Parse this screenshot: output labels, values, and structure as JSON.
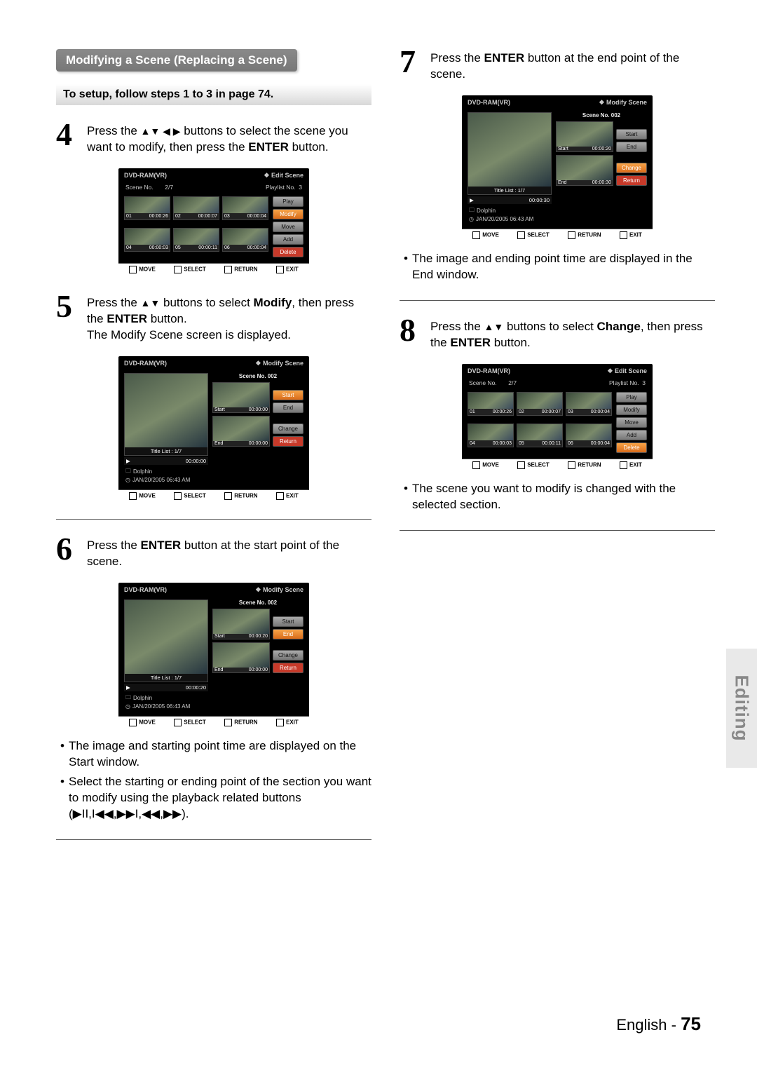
{
  "sidetab": "Editing",
  "footer": {
    "lang": "English -",
    "page": "75"
  },
  "left": {
    "banner": "Modifying a Scene (Replacing a Scene)",
    "subnote": "To setup, follow steps 1 to 3 in page 74.",
    "step4": {
      "num": "4",
      "t1": "Press the ",
      "arrows": "▲▼ ◀ ▶",
      "t2": " buttons to select the scene you want to modify, then press the ",
      "b1": "ENTER",
      "t3": " button."
    },
    "step5": {
      "num": "5",
      "t1": "Press the ",
      "arrows": "▲▼",
      "t2": " buttons to select ",
      "b1": "Modify",
      "t3": ", then press the ",
      "b2": "ENTER",
      "t4": " button.",
      "extra": "The Modify Scene screen is displayed."
    },
    "step6": {
      "num": "6",
      "t1": "Press the ",
      "b1": "ENTER",
      "t2": " button at the start point of the scene."
    },
    "bullets6": [
      "The image and starting point time are displayed on the Start window.",
      "Select the starting or ending point of the section you want to modify using the playback related buttons (▶II,I◀◀,▶▶I,◀◀,▶▶)."
    ]
  },
  "right": {
    "step7": {
      "num": "7",
      "t1": "Press the ",
      "b1": "ENTER",
      "t2": " button at the end point of the scene."
    },
    "bullets7": [
      "The image and ending point time are displayed in the End window."
    ],
    "step8": {
      "num": "8",
      "t1": "Press the ",
      "arrows": "▲▼",
      "t2": " buttons to select ",
      "b1": "Change",
      "t3": ", then press the ",
      "b2": "ENTER",
      "t4": " button."
    },
    "bullets8": [
      "The scene you want to modify is changed with the selected section."
    ]
  },
  "mock_common": {
    "disc": "DVD-RAM(VR)",
    "bottombar": {
      "move": "MOVE",
      "select": "SELECT",
      "return": "RETURN",
      "exit": "EXIT"
    },
    "editscene": "Edit Scene",
    "modifyscene": "Modify Scene",
    "sceneno_row_label": "Scene No.",
    "scenecount": "2/7",
    "playlist_label": "Playlist No.",
    "playlist_num": "3",
    "title_list": "Title List : 1/7",
    "dolphin": "Dolphin",
    "date": "JAN/20/2005 06:43 AM",
    "scene_no_hdr": "Scene No. 002",
    "labels": {
      "start": "Start",
      "end": "End",
      "change": "Change",
      "return": "Return"
    },
    "side": {
      "play": "Play",
      "modify": "Modify",
      "move": "Move",
      "add": "Add",
      "delete": "Delete"
    }
  },
  "mockA": {
    "thumbs": [
      {
        "idx": "01",
        "t": "00:00:26"
      },
      {
        "idx": "02",
        "t": "00:00:07"
      },
      {
        "idx": "03",
        "t": "00:00:04"
      },
      {
        "idx": "04",
        "t": "00:00:03"
      },
      {
        "idx": "05",
        "t": "00:00:11"
      },
      {
        "idx": "06",
        "t": "00:00:04"
      }
    ],
    "highlight": "modify"
  },
  "mockB": {
    "play_time": "00:00:00",
    "start_t": "00:00:00",
    "end_t": "00:00:00",
    "highlight": "start"
  },
  "mockC": {
    "play_time": "00:00:20",
    "start_t": "00:00:20",
    "end_t": "00:00:00",
    "highlight": "end"
  },
  "mockD": {
    "play_time": "00:00:30",
    "start_t": "00:00:20",
    "end_t": "00:00:30",
    "highlight": "change"
  },
  "mockE": {
    "thumbs": [
      {
        "idx": "01",
        "t": "00:00:26"
      },
      {
        "idx": "02",
        "t": "00:00:07"
      },
      {
        "idx": "03",
        "t": "00:00:04"
      },
      {
        "idx": "04",
        "t": "00:00:03"
      },
      {
        "idx": "05",
        "t": "00:00:11"
      },
      {
        "idx": "06",
        "t": "00:00:04"
      }
    ],
    "highlight": "delete"
  }
}
